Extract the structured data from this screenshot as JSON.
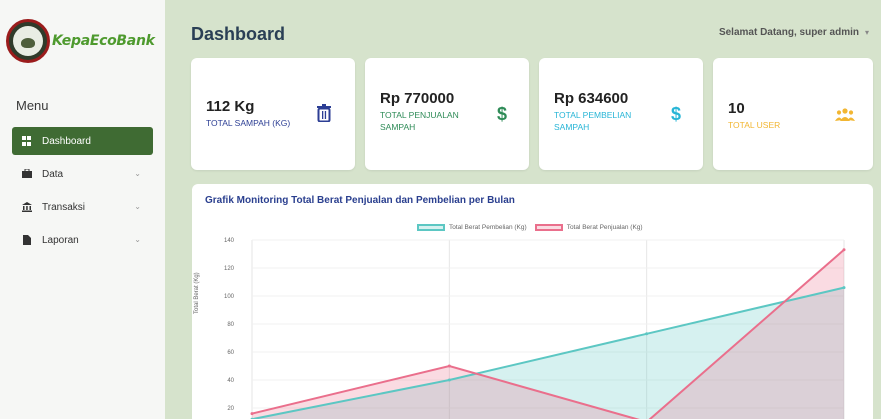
{
  "brand": {
    "name": "KepaEcoBank",
    "logo_icon": "bank-logo-icon"
  },
  "sidebar": {
    "menu_title": "Menu",
    "items": [
      {
        "label": "Dashboard",
        "icon": "dashboard-icon",
        "active": true,
        "expandable": false
      },
      {
        "label": "Data",
        "icon": "briefcase-icon",
        "active": false,
        "expandable": true
      },
      {
        "label": "Transaksi",
        "icon": "bank-icon",
        "active": false,
        "expandable": true
      },
      {
        "label": "Laporan",
        "icon": "document-icon",
        "active": false,
        "expandable": true
      }
    ]
  },
  "header": {
    "title": "Dashboard",
    "greeting": "Selamat Datang, super admin"
  },
  "cards": [
    {
      "value": "112 Kg",
      "label": "TOTAL SAMPAH (KG)",
      "icon": "trash-icon",
      "color": "#2c3e94"
    },
    {
      "value": "Rp 770000",
      "label": "TOTAL PENJUALAN SAMPAH",
      "icon": "dollar-icon",
      "color": "#2e8b57"
    },
    {
      "value": "Rp 634600",
      "label": "TOTAL PEMBELIAN SAMPAH",
      "icon": "dollar-icon",
      "color": "#27b5d6"
    },
    {
      "value": "10",
      "label": "TOTAL USER",
      "icon": "users-icon",
      "color": "#f2b632"
    }
  ],
  "chart_data": {
    "type": "line",
    "title": "Grafik Monitoring Total Berat Penjualan dan Pembelian per Bulan",
    "ylabel": "Total Berat (Kg)",
    "xlabel": "",
    "ylim": [
      0,
      140
    ],
    "yticks": [
      20,
      40,
      60,
      80,
      100,
      120,
      140
    ],
    "x": [
      0,
      1,
      2,
      3
    ],
    "series": [
      {
        "name": "Total Berat Pembelian (Kg)",
        "color": "#5cc7c3",
        "fill": "rgba(92,199,195,0.25)",
        "values": [
          12,
          40,
          73,
          106
        ]
      },
      {
        "name": "Total Berat Penjualan (Kg)",
        "color": "#ea6f8c",
        "fill": "rgba(234,111,140,0.25)",
        "values": [
          16,
          50,
          10,
          133
        ]
      }
    ],
    "grid": true,
    "legend": "top-center"
  }
}
